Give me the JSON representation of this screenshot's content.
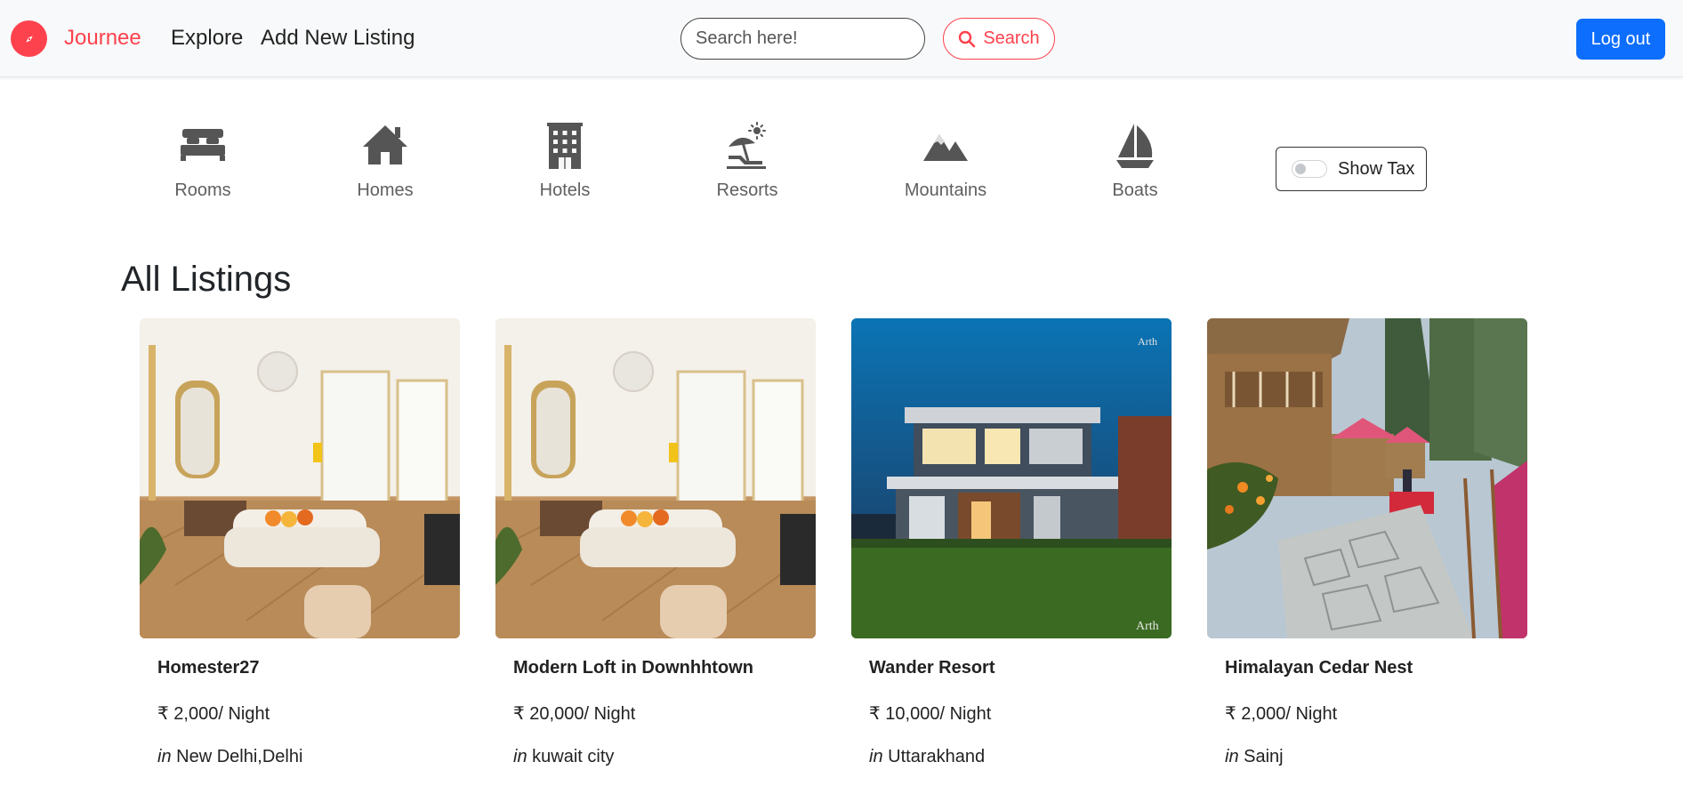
{
  "navbar": {
    "brand": "Journee",
    "links": [
      "Explore",
      "Add New Listing"
    ],
    "search_placeholder": "Search here!",
    "search_button": "Search",
    "logout_button": "Log out"
  },
  "filters": [
    {
      "label": "Rooms",
      "icon": "bed-icon"
    },
    {
      "label": "Homes",
      "icon": "house-icon"
    },
    {
      "label": "Hotels",
      "icon": "hotel-building-icon"
    },
    {
      "label": "Resorts",
      "icon": "umbrella-beach-icon"
    },
    {
      "label": "Mountains",
      "icon": "mountain-icon"
    },
    {
      "label": "Boats",
      "icon": "sailboat-icon"
    }
  ],
  "tax_toggle": {
    "label": "Show Tax",
    "checked": false
  },
  "listings_heading": "All Listings",
  "listings": [
    {
      "title": "Homester27",
      "price": "₹ 2,000/ Night",
      "location_prefix": "in",
      "location": "New Delhi,Delhi"
    },
    {
      "title": "Modern Loft in Downhhtown",
      "price": "₹ 20,000/ Night",
      "location_prefix": "in",
      "location": "kuwait city"
    },
    {
      "title": "Wander Resort",
      "price": "₹ 10,000/ Night",
      "location_prefix": "in",
      "location": "Uttarakhand"
    },
    {
      "title": "Himalayan Cedar Nest",
      "price": "₹ 2,000/ Night",
      "location_prefix": "in",
      "location": "Sainj"
    }
  ],
  "image_watermarks": {
    "resort": "Arth"
  },
  "colors": {
    "brand": "#fe424d",
    "primary": "#0d6efd",
    "icon_gray": "#555555"
  }
}
